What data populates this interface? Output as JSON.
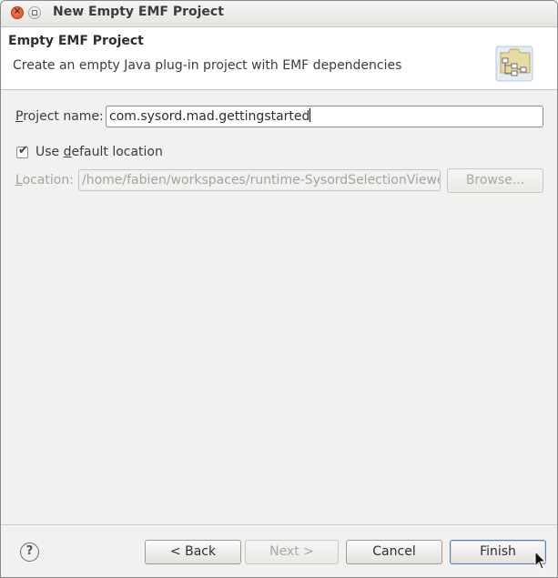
{
  "window": {
    "title": "New Empty EMF Project",
    "close_glyph": "×"
  },
  "header": {
    "title": "Empty EMF Project",
    "description": "Create an empty Java plug-in project with EMF dependencies",
    "icon": "wizard-banner-icon"
  },
  "form": {
    "project_name": {
      "label_mnemonic": "P",
      "label_rest": "roject name:",
      "value": "com.sysord.mad.gettingstarted"
    },
    "use_default_location": {
      "checked": true,
      "check_glyph": "✔",
      "label_prefix": "Use ",
      "label_mnemonic": "d",
      "label_rest": "efault location"
    },
    "location": {
      "label_mnemonic": "L",
      "label_rest": "ocation:",
      "value": "/home/fabien/workspaces/runtime-SysordSelectionViewer",
      "enabled": false
    },
    "browse_label": "Browse..."
  },
  "footer": {
    "help_glyph": "?",
    "back_label": "< Back",
    "next_label": "Next >",
    "cancel_label": "Cancel",
    "finish_label": "Finish"
  }
}
